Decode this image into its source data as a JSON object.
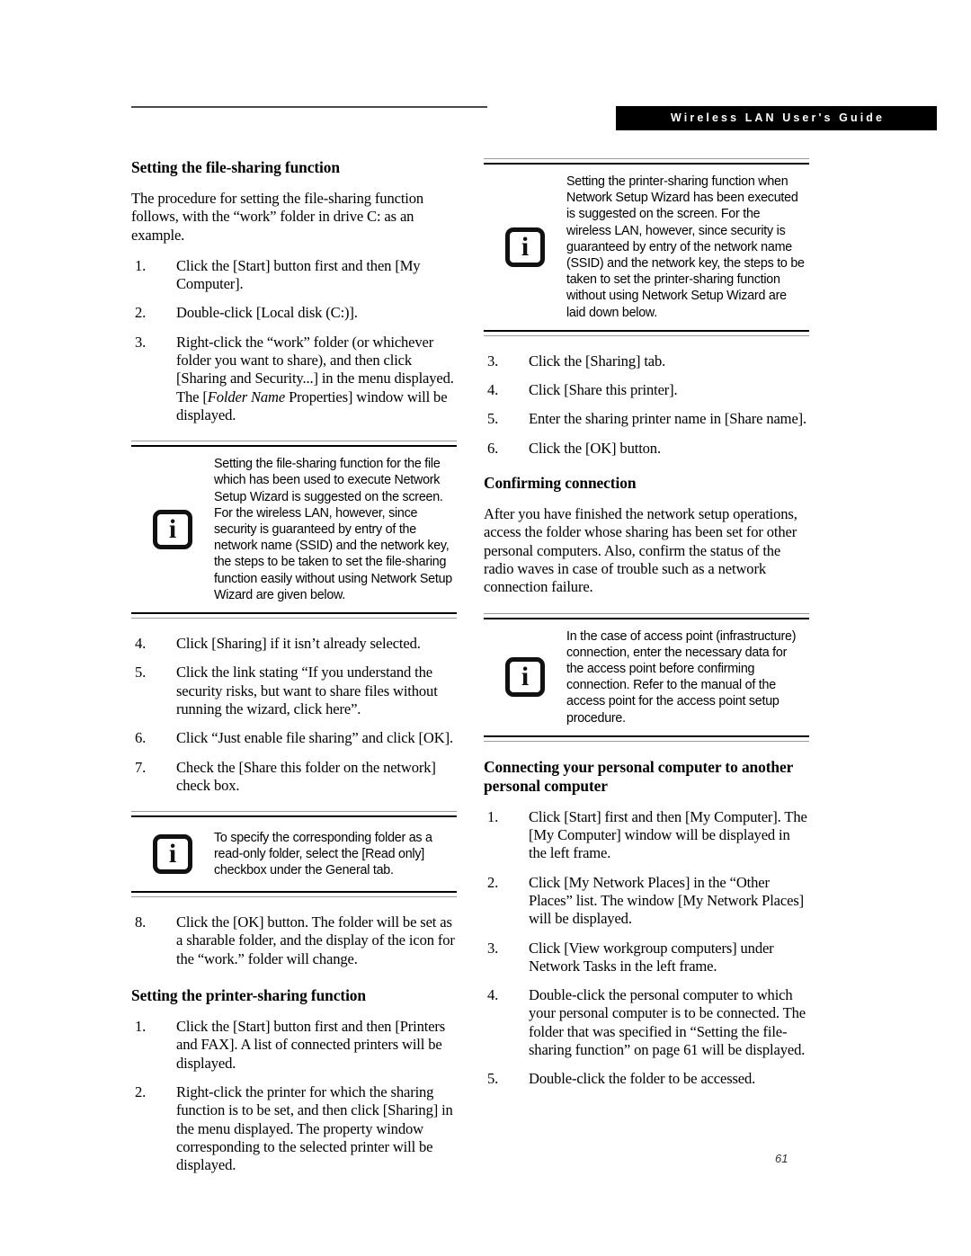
{
  "header": {
    "banner_title": "Wireless LAN User's Guide",
    "rule": "horizontal-rule"
  },
  "page_number": "61",
  "icons": {
    "info": "i"
  },
  "left_column": {
    "heading_1": "Setting the file-sharing function",
    "intro_paragraph": "The procedure for setting the file-sharing function follows, with the “work” folder in drive C: as an example.",
    "steps_1": [
      {
        "num": "1.",
        "text": "Click the [Start] button first and then [My Computer]."
      },
      {
        "num": "2.",
        "text": "Double-click [Local disk (C:)]."
      },
      {
        "num": "3.",
        "text_pre": "Right-click the “work” folder (or whichever folder you want to share), and then click [Sharing and Security...] in the menu displayed. The [",
        "text_italic": "Folder Name",
        "text_post": " Properties] window will be displayed."
      }
    ],
    "note_1": "Setting the file-sharing function for the file which has been used to execute Network Setup Wizard is suggested on the screen. For the wireless LAN, however, since security is guaranteed by entry of the network name (SSID) and the network key, the steps to be taken to set the file-sharing function easily without using Network Setup Wizard are given below.",
    "steps_2": [
      {
        "num": "4.",
        "text": "Click [Sharing] if it isn’t already selected."
      },
      {
        "num": "5.",
        "text": "Click the link stating “If you understand the security risks, but want to share files without running the wizard, click here”."
      },
      {
        "num": "6.",
        "text": "Click “Just enable file sharing” and click [OK]."
      },
      {
        "num": "7.",
        "text": "Check the [Share this folder on the network] check box."
      }
    ],
    "note_2": "To specify the corresponding folder as a read-only folder, select the [Read only] checkbox under the General tab.",
    "steps_3": [
      {
        "num": "8.",
        "text": "Click the [OK] button. The folder will be set as a sharable folder, and the display of the icon for the “work.” folder will change."
      }
    ],
    "heading_2": "Setting the printer-sharing function",
    "steps_4": [
      {
        "num": "1.",
        "text": "Click the [Start] button first and then [Printers and FAX]. A list of connected printers will be displayed."
      },
      {
        "num": "2.",
        "text": "Right-click the printer for which the sharing function is to be set, and then click [Sharing] in the menu displayed. The property window corresponding to the selected printer will be displayed."
      }
    ]
  },
  "right_column": {
    "note_1": "Setting the printer-sharing function when Network Setup Wizard has been executed is suggested on the screen. For the wireless LAN, however, since security is guaranteed by entry of the network name (SSID) and the network key, the steps to be taken to set the printer-sharing function without using Network Setup Wizard are laid down below.",
    "steps_1": [
      {
        "num": "3.",
        "text": "Click the [Sharing] tab."
      },
      {
        "num": "4.",
        "text": "Click [Share this printer]."
      },
      {
        "num": "5.",
        "text": "Enter the sharing printer name in [Share name]."
      },
      {
        "num": "6.",
        "text": "Click the [OK] button."
      }
    ],
    "heading_1": "Confirming connection",
    "paragraph_1": "After you have finished the network setup operations, access the folder whose sharing has been set for other personal computers. Also, confirm the status of the radio waves in case of trouble such as a network connection failure.",
    "note_2": "In the case of access point (infrastructure) connection, enter the necessary data for the access point before confirming connection. Refer to the manual of the access point for the access point setup procedure.",
    "heading_2": "Connecting your personal computer to another personal computer",
    "steps_2": [
      {
        "num": "1.",
        "text": "Click [Start] first and then [My Computer]. The [My Computer] window will be displayed in the left frame."
      },
      {
        "num": "2.",
        "text": "Click [My Network Places] in the “Other Places” list. The window [My Network Places] will be displayed."
      },
      {
        "num": "3.",
        "text": "Click [View workgroup computers] under Network Tasks in the left frame."
      },
      {
        "num": "4.",
        "text": "Double-click the personal computer to which your personal computer is to be connected. The folder that was specified in “Setting the file-sharing function” on page 61 will be displayed."
      },
      {
        "num": "5.",
        "text": "Double-click the folder to be accessed."
      }
    ]
  }
}
